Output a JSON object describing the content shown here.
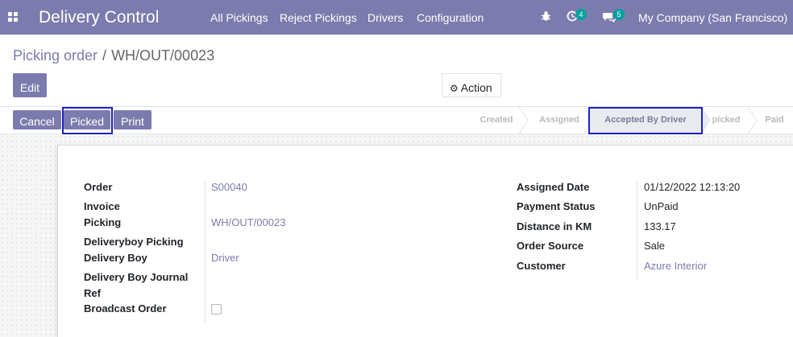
{
  "navbar": {
    "brand": "Delivery Control",
    "menu": [
      "All Pickings",
      "Reject Pickings",
      "Drivers",
      "Configuration"
    ],
    "activity_count": "4",
    "message_count": "5",
    "company": "My Company (San Francisco)"
  },
  "breadcrumb": {
    "parent": "Picking order",
    "separator": "/",
    "current": "WH/OUT/00023"
  },
  "buttons": {
    "edit": "Edit",
    "action": "Action",
    "cancel": "Cancel",
    "picked": "Picked",
    "print": "Print"
  },
  "stages": {
    "items": [
      "Created",
      "Assigned",
      "Accepted By Driver",
      "picked",
      "Paid"
    ],
    "active": "Accepted By Driver"
  },
  "form": {
    "left": {
      "order_label": "Order",
      "order_value": "S00040",
      "invoice_label": "Invoice",
      "picking_label": "Picking",
      "picking_value": "WH/OUT/00023",
      "deliveryboy_picking_label": "Deliveryboy Picking",
      "delivery_boy_label": "Delivery Boy",
      "delivery_boy_value": "Driver",
      "journal_label_1": "Delivery Boy Journal",
      "journal_label_2": "Ref",
      "broadcast_label": "Broadcast Order"
    },
    "right": {
      "assigned_date_label": "Assigned Date",
      "assigned_date_value": "01/12/2022 12:13:20",
      "payment_status_label": "Payment Status",
      "payment_status_value": "UnPaid",
      "distance_label": "Distance in KM",
      "distance_value": "133.17",
      "order_source_label": "Order Source",
      "order_source_value": "Sale",
      "customer_label": "Customer",
      "customer_value": "Azure Interior"
    }
  },
  "colors": {
    "brand": "#7c7bad",
    "badge": "#00a09d",
    "highlight": "#1f22c2"
  }
}
